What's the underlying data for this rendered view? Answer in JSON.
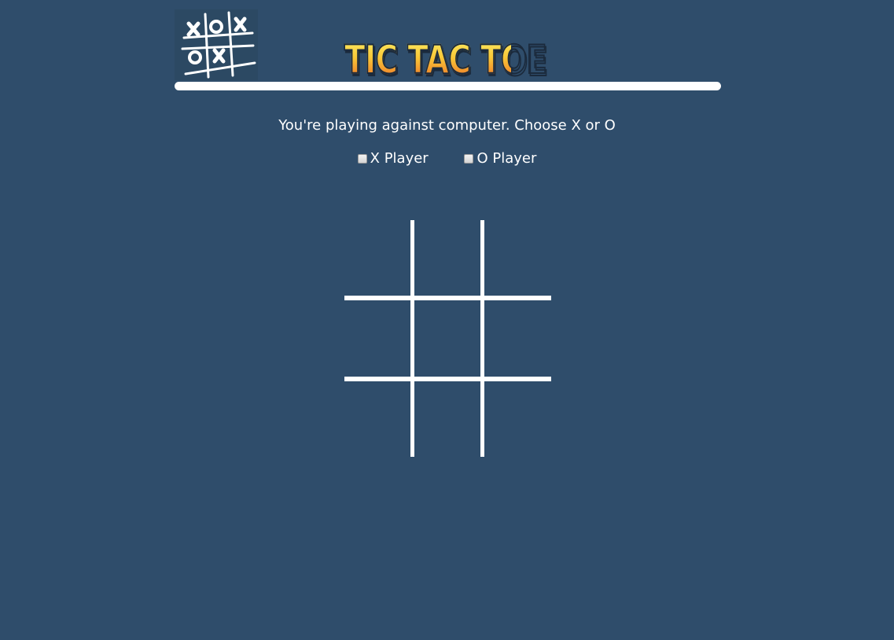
{
  "header": {
    "title": "TIC TAC TOE",
    "logo_icon": "tic-tac-toe-logo-icon"
  },
  "instruction": "You're playing against computer. Choose X or O",
  "choices": [
    {
      "label": "X Player",
      "checked": false
    },
    {
      "label": "O Player",
      "checked": false
    }
  ],
  "board": {
    "rows": 3,
    "cols": 3,
    "cells": [
      "",
      "",
      "",
      "",
      "",
      "",
      "",
      "",
      ""
    ]
  },
  "colors": {
    "background": "#2f4d6b",
    "foreground": "#ffffff",
    "title_top": "#fbf06a",
    "title_bottom": "#e2542a"
  }
}
